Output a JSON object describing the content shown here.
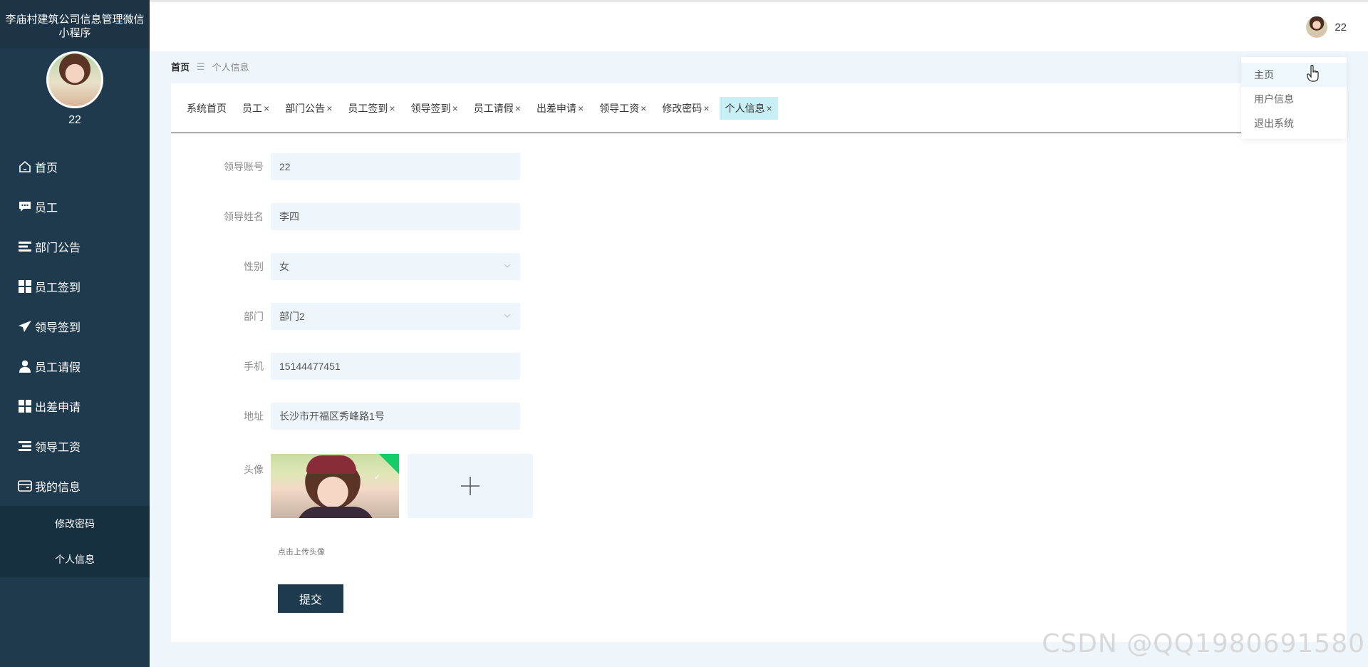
{
  "app": {
    "title": "李庙村建筑公司信息管理微信小程序",
    "username": "22"
  },
  "sidebar": {
    "menu": [
      {
        "label": "首页",
        "icon": "home-icon"
      },
      {
        "label": "员工",
        "icon": "chat-icon"
      },
      {
        "label": "部门公告",
        "icon": "list-icon"
      },
      {
        "label": "员工签到",
        "icon": "grid-icon"
      },
      {
        "label": "领导签到",
        "icon": "send-icon"
      },
      {
        "label": "员工请假",
        "icon": "user-icon"
      },
      {
        "label": "出差申请",
        "icon": "grid-icon"
      },
      {
        "label": "领导工资",
        "icon": "list-icon"
      },
      {
        "label": "我的信息",
        "icon": "wallet-icon"
      }
    ],
    "submenu": [
      "修改密码",
      "个人信息"
    ]
  },
  "topbar": {
    "username": "22"
  },
  "breadcrumb": {
    "home": "首页",
    "separator": "☰",
    "current": "个人信息"
  },
  "dropdown": [
    "主页",
    "用户信息",
    "退出系统"
  ],
  "tabs": [
    {
      "label": "系统首页",
      "closable": false
    },
    {
      "label": "员工",
      "closable": true
    },
    {
      "label": "部门公告",
      "closable": true
    },
    {
      "label": "员工签到",
      "closable": true
    },
    {
      "label": "领导签到",
      "closable": true
    },
    {
      "label": "员工请假",
      "closable": true
    },
    {
      "label": "出差申请",
      "closable": true
    },
    {
      "label": "领导工资",
      "closable": true
    },
    {
      "label": "修改密码",
      "closable": true
    },
    {
      "label": "个人信息",
      "closable": true,
      "active": true
    }
  ],
  "form": {
    "account_label": "领导账号",
    "account_value": "22",
    "name_label": "领导姓名",
    "name_value": "李四",
    "gender_label": "性别",
    "gender_value": "女",
    "dept_label": "部门",
    "dept_value": "部门2",
    "phone_label": "手机",
    "phone_value": "15144477451",
    "address_label": "地址",
    "address_value": "长沙市开福区秀峰路1号",
    "avatar_label": "头像",
    "upload_hint": "点击上传头像",
    "submit_label": "提交"
  },
  "watermark": "CSDN @QQ1980691580",
  "colors": {
    "sidebar": "#1f3a4d",
    "submenu": "#163040",
    "accent_tab": "#c6f0f6",
    "submit": "#1e3a4f",
    "input_bg": "#eef6fc"
  }
}
